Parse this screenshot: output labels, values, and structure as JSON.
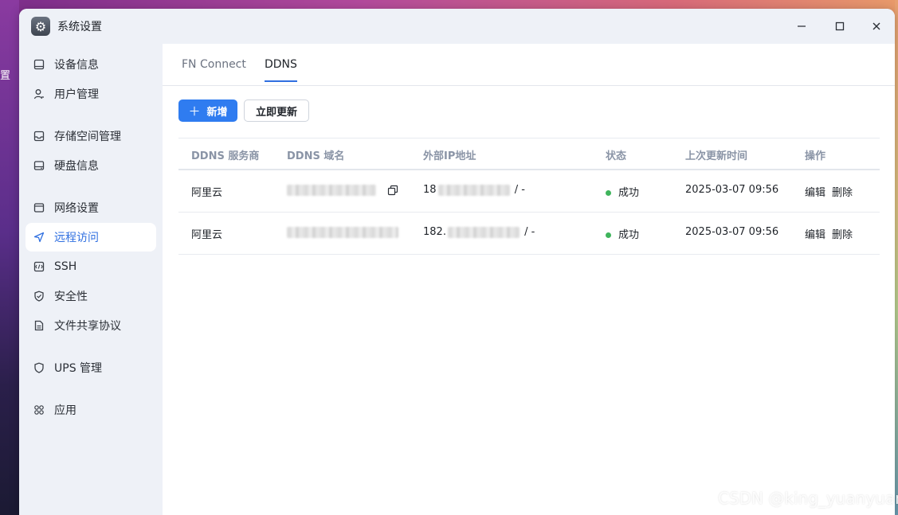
{
  "window": {
    "title": "系统设置",
    "controls": [
      "minimize-icon",
      "maximize-icon",
      "close-icon"
    ]
  },
  "sidebar": {
    "items": [
      {
        "label": "设备信息",
        "icon": "device-info-icon"
      },
      {
        "label": "用户管理",
        "icon": "user-icon"
      },
      {
        "label": "存储空间管理",
        "icon": "storage-icon"
      },
      {
        "label": "硬盘信息",
        "icon": "disk-icon"
      },
      {
        "label": "网络设置",
        "icon": "network-icon"
      },
      {
        "label": "远程访问",
        "icon": "send-icon",
        "active": true
      },
      {
        "label": "SSH",
        "icon": "terminal-icon"
      },
      {
        "label": "安全性",
        "icon": "shield-check-icon"
      },
      {
        "label": "文件共享协议",
        "icon": "document-icon"
      },
      {
        "label": "UPS 管理",
        "icon": "shield-icon"
      },
      {
        "label": "应用",
        "icon": "apps-icon"
      }
    ]
  },
  "tabs": [
    {
      "label": "FN Connect",
      "active": false
    },
    {
      "label": "DDNS",
      "active": true
    }
  ],
  "toolbar": {
    "add_label": "新增",
    "update_label": "立即更新"
  },
  "table": {
    "columns": [
      "DDNS 服务商",
      "DDNS 域名",
      "外部IP地址",
      "状态",
      "上次更新时间",
      "操作"
    ],
    "rows": [
      {
        "provider": "阿里云",
        "ip_prefix": "18",
        "ip_suffix": "/ -",
        "status": "成功",
        "updated": "2025-03-07 09:56",
        "edit": "编辑",
        "delete": "删除"
      },
      {
        "provider": "阿里云",
        "ip_prefix": "182.",
        "ip_suffix": "/ -",
        "status": "成功",
        "updated": "2025-03-07 09:56",
        "edit": "编辑",
        "delete": "删除"
      }
    ]
  },
  "desktop": {
    "left_fragment": "置"
  },
  "watermark": "CSDN @king_yuanyuan",
  "colors": {
    "accent": "#2f7cf0",
    "success": "#3fb45c",
    "sidebar_bg": "#eef1f7"
  }
}
